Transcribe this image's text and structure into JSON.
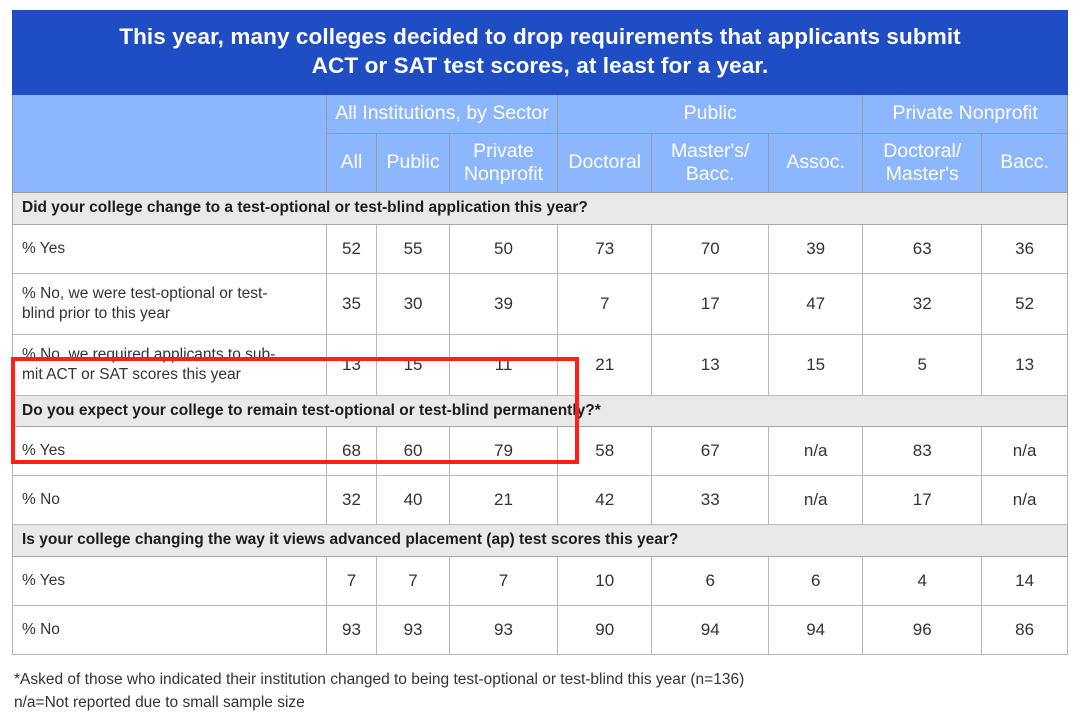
{
  "title": "This year, many colleges decided to drop requirements that applicants submit ACT or SAT test scores, at least for a year.",
  "title_line1": "This year, many colleges decided to drop requirements that applicants submit",
  "title_line2": "ACT or SAT test scores, at least for a year.",
  "colors": {
    "title_banner": "#1f4dc4",
    "header_blue": "#8cb6fd",
    "section_band": "#e9e9e9",
    "highlight_red": "#ff1f14",
    "grid_line": "#b8b8b8"
  },
  "header": {
    "groups": [
      {
        "label": "",
        "span": 1
      },
      {
        "label": "All Institutions, by Sector",
        "span": 3
      },
      {
        "label": "Public",
        "span": 3
      },
      {
        "label": "Private Nonprofit",
        "span": 2
      }
    ],
    "columns": [
      {
        "label": "All"
      },
      {
        "label": "Public"
      },
      {
        "label": "Private Nonprofit",
        "line1": "Private",
        "line2": "Nonprofit"
      },
      {
        "label": "Doctoral"
      },
      {
        "label": "Master's/ Bacc.",
        "line1": "Master's/",
        "line2": "Bacc."
      },
      {
        "label": "Assoc."
      },
      {
        "label": "Doctoral/ Master's",
        "line1": "Doctoral/",
        "line2": "Master's"
      },
      {
        "label": "Bacc."
      }
    ]
  },
  "sections": [
    {
      "question": "Did your college change to a test-optional or test-blind application this year?",
      "rows": [
        {
          "label": "% Yes",
          "label_line1": "% Yes",
          "label_line2": "",
          "values": [
            "52",
            "55",
            "50",
            "73",
            "70",
            "39",
            "63",
            "36"
          ]
        },
        {
          "label": "% No, we were test-optional or test-blind prior to this year",
          "label_line1": "% No, we were test-optional or test-",
          "label_line2": "blind prior to this year",
          "values": [
            "35",
            "30",
            "39",
            "7",
            "17",
            "47",
            "32",
            "52"
          ]
        },
        {
          "label": "% No, we required applicants to submit ACT or SAT scores this year",
          "label_line1": "% No, we required applicants to sub-",
          "label_line2": "mit ACT or SAT scores this year",
          "values": [
            "13",
            "15",
            "11",
            "21",
            "13",
            "15",
            "5",
            "13"
          ]
        }
      ]
    },
    {
      "question": "Do you expect your college to remain test-optional or test-blind permanently?*",
      "rows": [
        {
          "label": "% Yes",
          "label_line1": "% Yes",
          "label_line2": "",
          "values": [
            "68",
            "60",
            "79",
            "58",
            "67",
            "n/a",
            "83",
            "n/a"
          ]
        },
        {
          "label": "% No",
          "label_line1": "% No",
          "label_line2": "",
          "values": [
            "32",
            "40",
            "21",
            "42",
            "33",
            "n/a",
            "17",
            "n/a"
          ]
        }
      ]
    },
    {
      "question": "Is your college changing the way it views advanced placement (ap) test scores this year?",
      "rows": [
        {
          "label": "% Yes",
          "label_line1": "% Yes",
          "label_line2": "",
          "values": [
            "7",
            "7",
            "7",
            "10",
            "6",
            "6",
            "4",
            "14"
          ]
        },
        {
          "label": "% No",
          "label_line1": "% No",
          "label_line2": "",
          "values": [
            "93",
            "93",
            "93",
            "90",
            "94",
            "94",
            "96",
            "86"
          ]
        }
      ]
    }
  ],
  "footnotes": [
    "*Asked of those who indicated their institution changed to being test-optional or test-blind this year (n=136)",
    "n/a=Not reported due to small sample size"
  ]
}
